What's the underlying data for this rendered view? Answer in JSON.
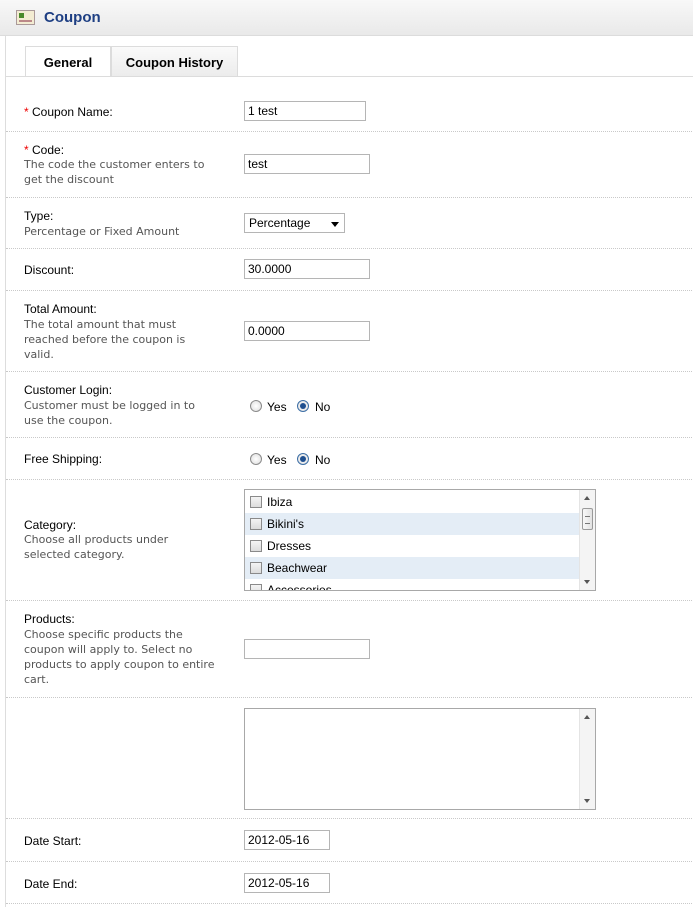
{
  "header": {
    "title": "Coupon",
    "icon": "coupon-logo-icon"
  },
  "tabs": [
    {
      "label": "General",
      "active": true
    },
    {
      "label": "Coupon History",
      "active": false
    }
  ],
  "form": {
    "coupon_name": {
      "label": "Coupon Name:",
      "required": "*",
      "value": "1 test"
    },
    "code": {
      "label": "Code:",
      "required": "*",
      "help": "The code the customer enters to get the discount",
      "value": "test"
    },
    "type": {
      "label": "Type:",
      "help": "Percentage or Fixed Amount",
      "value": "Percentage"
    },
    "discount": {
      "label": "Discount:",
      "value": "30.0000"
    },
    "total_amount": {
      "label": "Total Amount:",
      "help": "The total amount that must reached before the coupon is valid.",
      "value": "0.0000"
    },
    "customer_login": {
      "label": "Customer Login:",
      "help": "Customer must be logged in to use the coupon.",
      "yes": "Yes",
      "no": "No",
      "selected": "No"
    },
    "free_shipping": {
      "label": "Free Shipping:",
      "yes": "Yes",
      "no": "No",
      "selected": "No"
    },
    "category": {
      "label": "Category:",
      "help": "Choose all products under selected category.",
      "items": [
        "Ibiza",
        "Bikini's",
        "Dresses",
        "Beachwear",
        "Accessories"
      ]
    },
    "products": {
      "label": "Products:",
      "help": "Choose specific products the coupon will apply to. Select no products to apply coupon to entire cart.",
      "value": ""
    },
    "date_start": {
      "label": "Date Start:",
      "value": "2012-05-16"
    },
    "date_end": {
      "label": "Date End:",
      "value": "2012-05-16"
    }
  }
}
